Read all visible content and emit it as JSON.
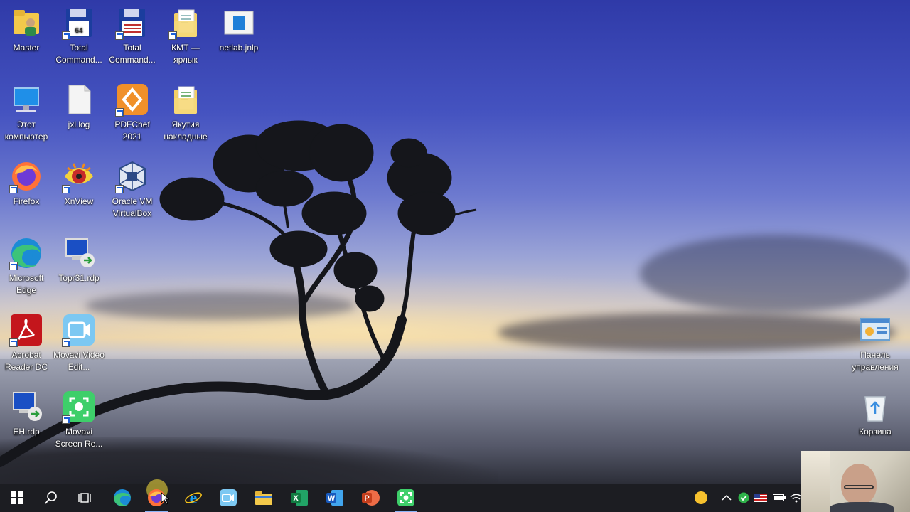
{
  "desktop": {
    "icons": [
      {
        "label": "Master",
        "icon": "folder-user-icon"
      },
      {
        "label": "Total Command...",
        "icon": "floppy-icon"
      },
      {
        "label": "Total Command...",
        "icon": "floppy-icon"
      },
      {
        "label": "КМТ — ярлык",
        "icon": "folder-docs-icon"
      },
      {
        "label": "netlab.jnlp",
        "icon": "jnlp-file-icon"
      },
      {
        "label": "Этот компьютер",
        "icon": "computer-icon"
      },
      {
        "label": "jxl.log",
        "icon": "text-file-icon"
      },
      {
        "label": "PDFChef 2021",
        "icon": "pdfchef-icon"
      },
      {
        "label": "Якутия накладные",
        "icon": "folder-docs-icon"
      },
      {
        "label": "Firefox",
        "icon": "firefox-icon"
      },
      {
        "label": "XnView",
        "icon": "xnview-eye-icon"
      },
      {
        "label": "Oracle VM VirtualBox",
        "icon": "virtualbox-icon"
      },
      {
        "label": "Microsoft Edge",
        "icon": "edge-icon"
      },
      {
        "label": "Topr31.rdp",
        "icon": "rdp-icon"
      },
      {
        "label": "Acrobat Reader DC",
        "icon": "acrobat-icon"
      },
      {
        "label": "Movavi Video Edit...",
        "icon": "movavi-video-icon"
      },
      {
        "label": "EH.rdp",
        "icon": "rdp-icon"
      },
      {
        "label": "Movavi Screen Re...",
        "icon": "movavi-screen-icon"
      },
      {
        "label": "Панель управления",
        "icon": "control-panel-icon"
      },
      {
        "label": "Корзина",
        "icon": "recycle-bin-icon"
      }
    ]
  },
  "taskbar": {
    "items": [
      {
        "name": "start",
        "icon": "windows-start-icon"
      },
      {
        "name": "search",
        "icon": "search-icon"
      },
      {
        "name": "task-view",
        "icon": "task-view-icon"
      },
      {
        "name": "edge",
        "icon": "edge-icon"
      },
      {
        "name": "firefox",
        "icon": "firefox-icon"
      },
      {
        "name": "internet-explorer",
        "icon": "ie-icon"
      },
      {
        "name": "movavi",
        "icon": "movavi-video-icon"
      },
      {
        "name": "file-explorer",
        "icon": "folder-icon"
      },
      {
        "name": "excel",
        "icon": "excel-icon"
      },
      {
        "name": "word",
        "icon": "word-icon"
      },
      {
        "name": "powerpoint",
        "icon": "powerpoint-icon"
      },
      {
        "name": "movavi-screen",
        "icon": "movavi-screen-icon"
      }
    ],
    "tray": [
      "weather-sun-icon",
      "chevron-up-icon",
      "security-shield-icon",
      "flag-us-icon",
      "battery-icon",
      "wifi-icon"
    ]
  },
  "colors": {
    "taskbar": "#1c1d22",
    "accent": "#8ab4f8"
  }
}
